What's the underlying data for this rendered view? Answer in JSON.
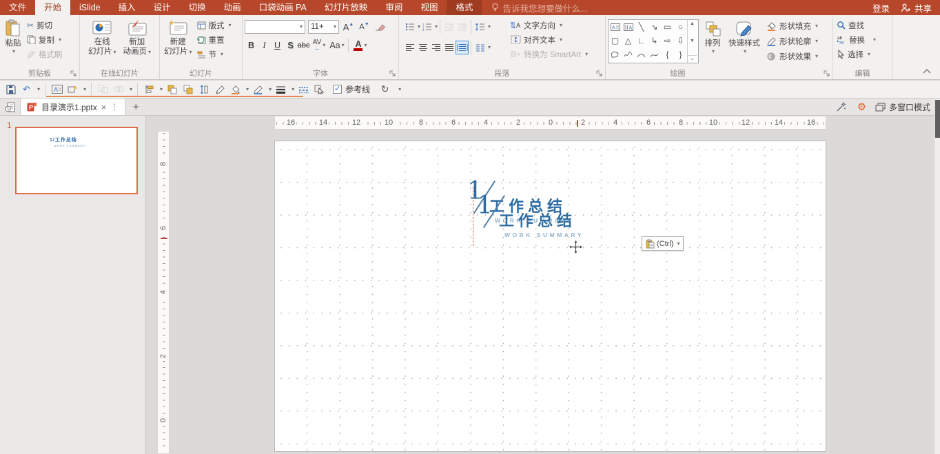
{
  "titlebar": {
    "tabs": [
      "文件",
      "开始",
      "iSlide",
      "插入",
      "设计",
      "切换",
      "动画",
      "口袋动画 PA",
      "幻灯片放映",
      "审阅",
      "视图",
      "格式"
    ],
    "tellme": "告诉我您想要做什么...",
    "login": "登录",
    "share": "共享"
  },
  "ribbon": {
    "clipboard": {
      "title": "剪贴板",
      "paste": "粘贴",
      "cut": "剪切",
      "copy": "复制",
      "format_painter": "格式刷"
    },
    "online": {
      "title": "在线幻灯片",
      "b1_line1": "在线",
      "b1_line2": "幻灯片",
      "b2_line1": "新加",
      "b2_line2": "动画页"
    },
    "slides": {
      "title": "幻灯片",
      "new_line1": "新建",
      "new_line2": "幻灯片",
      "layout": "版式",
      "reset": "重置",
      "section": "节"
    },
    "font": {
      "title": "字体",
      "name": "",
      "size": "11+",
      "grow": "A",
      "shrink": "A",
      "bold": "B",
      "italic": "I",
      "underline": "U",
      "shadow": "S",
      "strike": "abc",
      "spacing": "AV",
      "case": "Aa",
      "color": "A"
    },
    "paragraph": {
      "title": "段落",
      "direction": "文字方向",
      "align_text": "对齐文本",
      "smartart": "转换为 SmartArt"
    },
    "drawing": {
      "title": "绘图",
      "arrange": "排列",
      "quick": "快速样式",
      "fill": "形状填充",
      "outline": "形状轮廓",
      "effects": "形状效果"
    },
    "editing": {
      "title": "编辑",
      "find": "查找",
      "replace": "替换",
      "select": "选择"
    }
  },
  "qat": {
    "guides": "参考线"
  },
  "tabbar": {
    "doc": "目录演示1.pptx",
    "multiwindow": "多窗口模式"
  },
  "slide": {
    "number": "1",
    "digit": "1",
    "title_cn": "工作总结",
    "title_en": "WORK SUMMARY",
    "paste_btn": "(Ctrl)"
  },
  "rulers": {
    "h": [
      "16",
      "14",
      "12",
      "10",
      "8",
      "6",
      "4",
      "2",
      "0",
      "2",
      "4",
      "6",
      "8",
      "10",
      "12",
      "14",
      "16"
    ],
    "v": [
      "8",
      "6",
      "4",
      "2",
      "0"
    ]
  },
  "icons": {
    "dropdown": "▾",
    "scroll_up": "▲",
    "scroll_down": "▼",
    "scroll_more": "⌄",
    "close": "×",
    "more": "⋮",
    "plus": "+",
    "gear": "⚙",
    "scissors": "✂",
    "check": "✓",
    "undo": "↶",
    "rotate": "↻",
    "shape_line": "╲",
    "shape_arrow_se": "↘",
    "shape_rect": "▭",
    "shape_oval": "○",
    "shape_round_rect": "▢",
    "shape_triangle": "△",
    "shape_elbow": "∟",
    "shape_elbow_arrow": "↳",
    "shape_arrow_right": "⇨",
    "shape_arrow_down": "⇩",
    "brace_left": "{",
    "brace_right": "}"
  },
  "colors": {
    "accent": "#B7472A",
    "tab_dark": "#9E3B20",
    "selection": "#DF6A4C",
    "slide_blue": "#2E6DA4",
    "slide_blue_light": "#8FB2CD",
    "qat_accent": "#E08A53"
  }
}
